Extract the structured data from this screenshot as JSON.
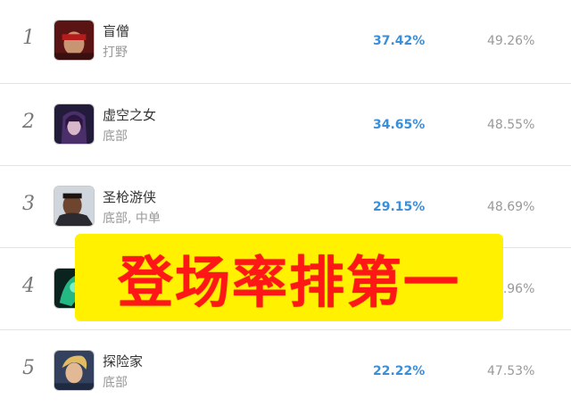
{
  "rows": [
    {
      "rank": "1",
      "name": "盲僧",
      "role": "打野",
      "pick_rate": "37.42%",
      "win_rate": "49.26%",
      "avatar": "lee-sin-avatar",
      "colors": [
        "#7a1c1c",
        "#d3a27a"
      ]
    },
    {
      "rank": "2",
      "name": "虚空之女",
      "role": "底部",
      "pick_rate": "34.65%",
      "win_rate": "48.55%",
      "avatar": "kaisa-avatar",
      "colors": [
        "#2b2246",
        "#c9a7d8"
      ]
    },
    {
      "rank": "3",
      "name": "圣枪游侠",
      "role": "底部, 中单",
      "pick_rate": "29.15%",
      "win_rate": "48.69%",
      "avatar": "lucian-avatar",
      "colors": [
        "#3a2a22",
        "#8b5a3c"
      ]
    },
    {
      "rank": "4",
      "name": "",
      "role": "",
      "pick_rate": "",
      "win_rate": "49.96%",
      "avatar": "thresh-avatar",
      "colors": [
        "#0d2b25",
        "#2fd09a"
      ]
    },
    {
      "rank": "5",
      "name": "探险家",
      "role": "底部",
      "pick_rate": "22.22%",
      "win_rate": "47.53%",
      "avatar": "ezreal-avatar",
      "colors": [
        "#3b4a6b",
        "#e8c27a"
      ]
    }
  ],
  "overlay": {
    "text": "登场率排第一",
    "background": "#fff100",
    "color": "#ff1717"
  },
  "colors": {
    "pick_rate": "#3b8fd9",
    "win_rate": "#999999"
  }
}
